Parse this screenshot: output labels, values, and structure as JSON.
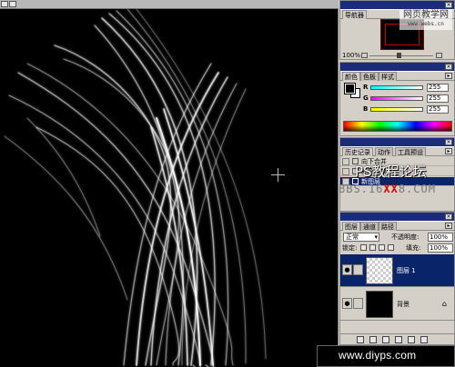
{
  "navigator": {
    "tabs": [
      "导航器"
    ],
    "zoom": "100%",
    "watermark_site": "网页教学网",
    "watermark_url": "www.webs.cn"
  },
  "color": {
    "tabs": [
      "颜色",
      "色板",
      "样式"
    ],
    "r_label": "R",
    "r_value": "255",
    "g_label": "G",
    "g_value": "255",
    "b_label": "B",
    "b_value": "255",
    "accent": "#0a246a"
  },
  "history": {
    "tabs": [
      "历史记录",
      "动作",
      "工具预设"
    ],
    "items": [
      "向下合并",
      "光照效果",
      "新图层"
    ]
  },
  "forum_overlay": {
    "title": "PS教程论坛",
    "url_pre": "BBS.16",
    "url_red": "XX",
    "url_post": "8.COM"
  },
  "layers": {
    "tabs": [
      "图层",
      "通道",
      "路径"
    ],
    "blend_mode": "正常",
    "opacity_label": "不透明度:",
    "opacity_value": "100%",
    "lock_label": "锁定:",
    "fill_label": "填充:",
    "fill_value": "100%",
    "rows": [
      {
        "name": "图层 1",
        "selected": true,
        "thumb": "transparent"
      },
      {
        "name": "背景",
        "selected": false,
        "thumb": "black"
      }
    ]
  },
  "canvas": {
    "footer_url": "www.diyps.com"
  }
}
